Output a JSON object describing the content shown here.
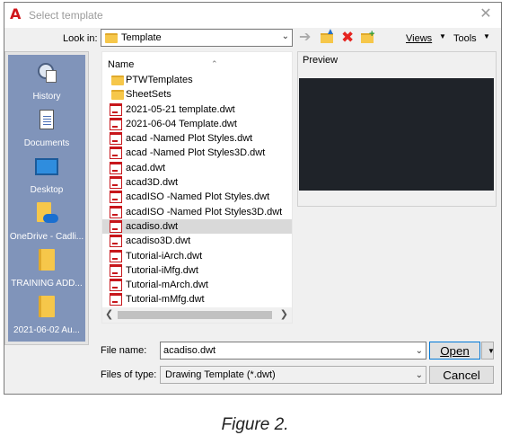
{
  "window": {
    "title": "Select template",
    "app_icon_glyph": "A",
    "close_glyph": "✕"
  },
  "toolbar": {
    "look_in_label": "Look in:",
    "look_in_value": "Template",
    "views_label": "Views",
    "tools_label": "Tools",
    "icons": [
      "back-icon",
      "up-one-level-icon",
      "delete-icon",
      "create-folder-icon"
    ]
  },
  "places": [
    {
      "label": "History",
      "icon": "history-icon"
    },
    {
      "label": "Documents",
      "icon": "documents-icon"
    },
    {
      "label": "Desktop",
      "icon": "desktop-icon"
    },
    {
      "label": "OneDrive - Cadli...",
      "icon": "onedrive-folder-icon"
    },
    {
      "label": "TRAINING ADD...",
      "icon": "folder-icon"
    },
    {
      "label": "2021-06-02 Au...",
      "icon": "folder-icon"
    }
  ],
  "file_list": {
    "column_header": "Name",
    "items": [
      {
        "name": "PTWTemplates",
        "type": "folder"
      },
      {
        "name": "SheetSets",
        "type": "folder"
      },
      {
        "name": "2021-05-21 template.dwt",
        "type": "dwt"
      },
      {
        "name": "2021-06-04 Template.dwt",
        "type": "dwt"
      },
      {
        "name": "acad -Named Plot Styles.dwt",
        "type": "dwt"
      },
      {
        "name": "acad -Named Plot Styles3D.dwt",
        "type": "dwt"
      },
      {
        "name": "acad.dwt",
        "type": "dwt"
      },
      {
        "name": "acad3D.dwt",
        "type": "dwt"
      },
      {
        "name": "acadISO -Named Plot Styles.dwt",
        "type": "dwt"
      },
      {
        "name": "acadISO -Named Plot Styles3D.dwt",
        "type": "dwt"
      },
      {
        "name": "acadiso.dwt",
        "type": "dwt",
        "selected": true
      },
      {
        "name": "acadiso3D.dwt",
        "type": "dwt"
      },
      {
        "name": "Tutorial-iArch.dwt",
        "type": "dwt"
      },
      {
        "name": "Tutorial-iMfg.dwt",
        "type": "dwt"
      },
      {
        "name": "Tutorial-mArch.dwt",
        "type": "dwt"
      },
      {
        "name": "Tutorial-mMfg.dwt",
        "type": "dwt"
      }
    ]
  },
  "preview": {
    "label": "Preview",
    "background": "#1f2329"
  },
  "form": {
    "file_name_label": "File name:",
    "file_name_value": "acadiso.dwt",
    "files_of_type_label": "Files of type:",
    "files_of_type_value": "Drawing Template (*.dwt)",
    "open_label": "Open",
    "cancel_label": "Cancel"
  },
  "caption": "Figure 2.",
  "colors": {
    "accent": "#0078d7",
    "places_bg": "#8094ba",
    "dwt_red": "#c7161b"
  }
}
